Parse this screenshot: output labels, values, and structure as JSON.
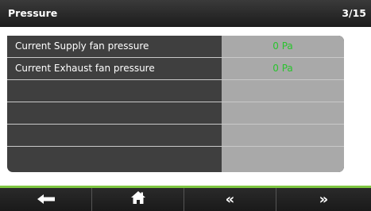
{
  "header": {
    "title": "Pressure",
    "page_indicator": "3/15"
  },
  "rows": [
    {
      "label": "Current Supply fan pressure",
      "value": "0 Pa"
    },
    {
      "label": "Current Exhaust fan pressure",
      "value": "0 Pa"
    },
    {
      "label": "",
      "value": ""
    },
    {
      "label": "",
      "value": ""
    },
    {
      "label": "",
      "value": ""
    },
    {
      "label": "",
      "value": ""
    }
  ],
  "nav": {
    "back_icon": "arrow-left-icon",
    "home_icon": "home-icon",
    "prev_icon": "double-chevron-left-icon",
    "next_icon": "double-chevron-right-icon"
  },
  "colors": {
    "value_green": "#29c42d",
    "accent_green": "#7fc742",
    "panel_dark": "#3f3f3f",
    "panel_light": "#a9a9a9"
  }
}
